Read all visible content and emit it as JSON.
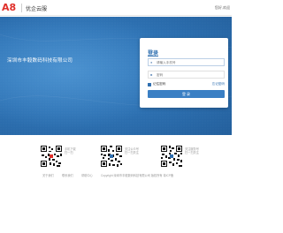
{
  "header": {
    "logo_text": "A8",
    "brand_name": "优企云服",
    "top_link": "您好,欢迎"
  },
  "hero": {
    "company_name": "深圳市丰毅数码科技有限公司"
  },
  "login": {
    "title": "登录",
    "username_placeholder": "请输入手机号",
    "password_placeholder": "密码",
    "remember_label": "记住密码",
    "forgot_label": "忘记密码",
    "submit_label": "登 录"
  },
  "qr_codes": [
    {
      "caption_a": "手机下载",
      "caption_b": "扫一扫"
    },
    {
      "caption_a": "关注公众号",
      "caption_b": "扫一扫关注"
    },
    {
      "caption_a": "关注服务号",
      "caption_b": "扫一扫关注"
    }
  ],
  "footer": {
    "links": [
      "关于我们",
      "联系我们",
      "帮助中心"
    ],
    "copyright": "Copyright 深圳市丰毅数码科技有限公司 版权所有 粤ICP备"
  },
  "colors": {
    "accent": "#2f6fb0",
    "hero_bg": "#2f74b6",
    "logo_red": "#e0302a"
  }
}
